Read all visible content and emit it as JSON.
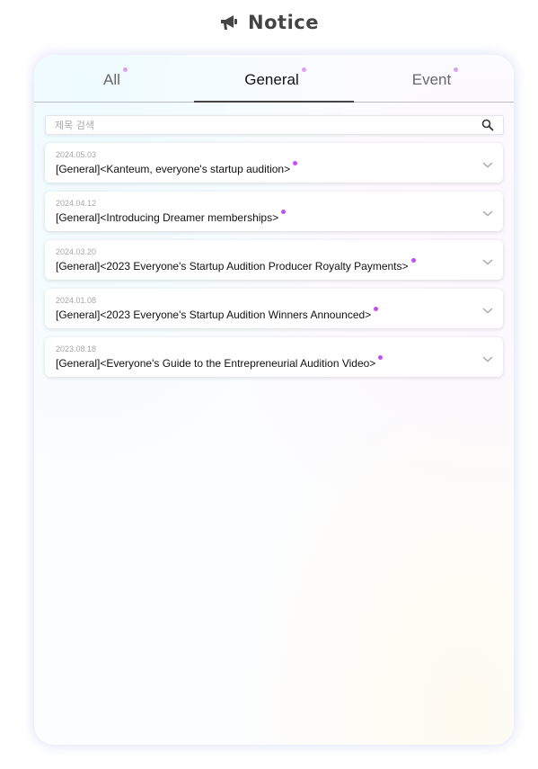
{
  "header": {
    "title": "Notice",
    "icon": "megaphone-icon"
  },
  "tabs": [
    {
      "label": "All",
      "active": false
    },
    {
      "label": "General",
      "active": true
    },
    {
      "label": "Event",
      "active": false
    }
  ],
  "search": {
    "placeholder": "제목 검색",
    "value": "",
    "icon": "search-icon"
  },
  "notices": [
    {
      "date": "2024.05.03",
      "title": "[General]<Kanteum, everyone's startup audition>"
    },
    {
      "date": "2024.04.12",
      "title": "[General]<Introducing Dreamer memberships>"
    },
    {
      "date": "2024.03.20",
      "title": "[General]<2023 Everyone's Startup Audition Producer Royalty Payments>"
    },
    {
      "date": "2024.01.08",
      "title": "[General]<2023 Everyone's Startup Audition Winners Announced>"
    },
    {
      "date": "2023.08.18",
      "title": "[General]<Everyone's Guide to the Entrepreneurial Audition Video>"
    }
  ],
  "colors": {
    "accent_dot": "#c44ef0",
    "tab_dot": "#e29cf0",
    "text": "#111111"
  }
}
